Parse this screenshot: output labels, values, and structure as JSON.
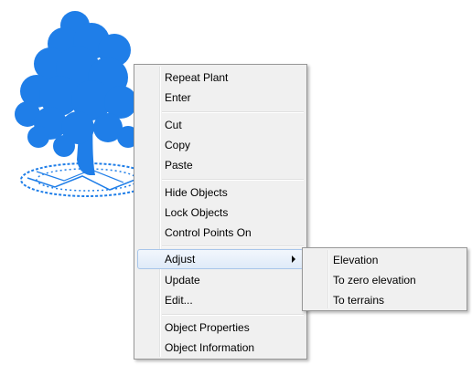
{
  "colors": {
    "tree_fill": "#1f7ee8",
    "menu_bg": "#f0f0f0",
    "highlight": "#dfeaf8"
  },
  "background": {
    "image": "tree-plant-icon"
  },
  "context_menu": {
    "items": [
      {
        "label": "Repeat Plant"
      },
      {
        "label": "Enter"
      },
      {
        "label": "Cut"
      },
      {
        "label": "Copy"
      },
      {
        "label": "Paste"
      },
      {
        "label": "Hide Objects"
      },
      {
        "label": "Lock Objects"
      },
      {
        "label": "Control Points On"
      },
      {
        "label": "Adjust",
        "icon": "chevron-right-icon"
      },
      {
        "label": "Update"
      },
      {
        "label": "Edit..."
      },
      {
        "label": "Object Properties"
      },
      {
        "label": "Object Information"
      }
    ]
  },
  "submenu": {
    "items": [
      {
        "label": "Elevation"
      },
      {
        "label": "To zero elevation"
      },
      {
        "label": "To terrains"
      }
    ]
  }
}
